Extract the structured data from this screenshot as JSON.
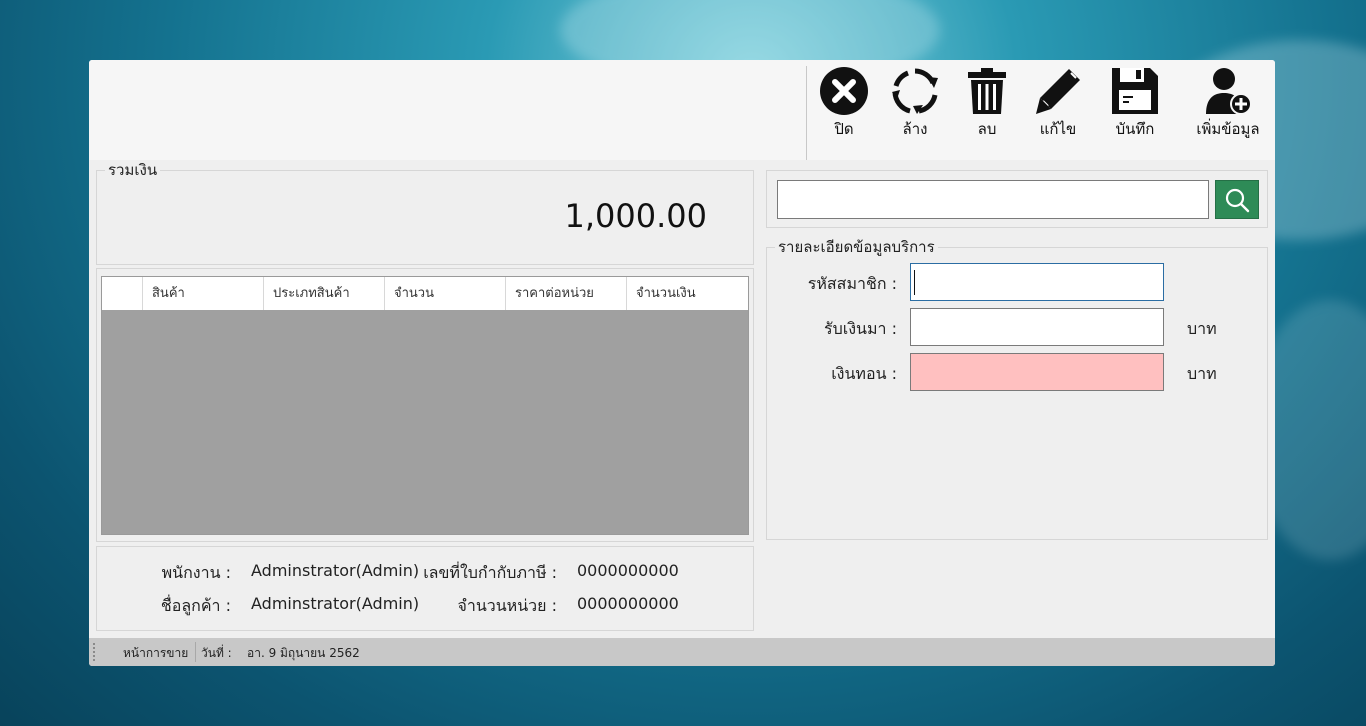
{
  "toolbar": {
    "close_label": "ปิด",
    "refresh_label": "ล้าง",
    "delete_label": "ลบ",
    "edit_label": "แก้ไข",
    "save_label": "บันทึก",
    "add_label": "เพิ่มข้อมูล"
  },
  "total": {
    "legend": "รวมเงิน",
    "amount": "1,000.00"
  },
  "grid": {
    "columns": [
      "สินค้า",
      "ประเภทสินค้า",
      "จำนวน",
      "ราคาต่อหน่วย",
      "จำนวนเงิน"
    ]
  },
  "info": {
    "employee_label": "พนักงาน :",
    "employee_value": "Adminstrator(Admin)",
    "tax_label": "เลขที่ใบกำกับภาษี :",
    "tax_value": "0000000000",
    "customer_label": "ชื่อลูกค้า :",
    "customer_value": "Adminstrator(Admin)",
    "units_label": "จำนวนหน่วย :",
    "units_value": "0000000000"
  },
  "search": {
    "value": "",
    "icon": "search-icon"
  },
  "service": {
    "legend": "รายละเอียดข้อมูลบริการ",
    "member_label": "รหัสสมาชิก :",
    "member_value": "",
    "received_label": "รับเงินมา :",
    "received_value": "",
    "received_unit": "บาท",
    "change_label": "เงินทอน :",
    "change_value": "",
    "change_unit": "บาท"
  },
  "status": {
    "page": "หน้าการขาย",
    "date_label": "วันที่ :",
    "date_value": "อา. 9 มิถุนายน 2562"
  },
  "colors": {
    "search_button": "#2e8b57",
    "change_field": "#ffc0c0",
    "grid_body": "#a0a0a0"
  }
}
